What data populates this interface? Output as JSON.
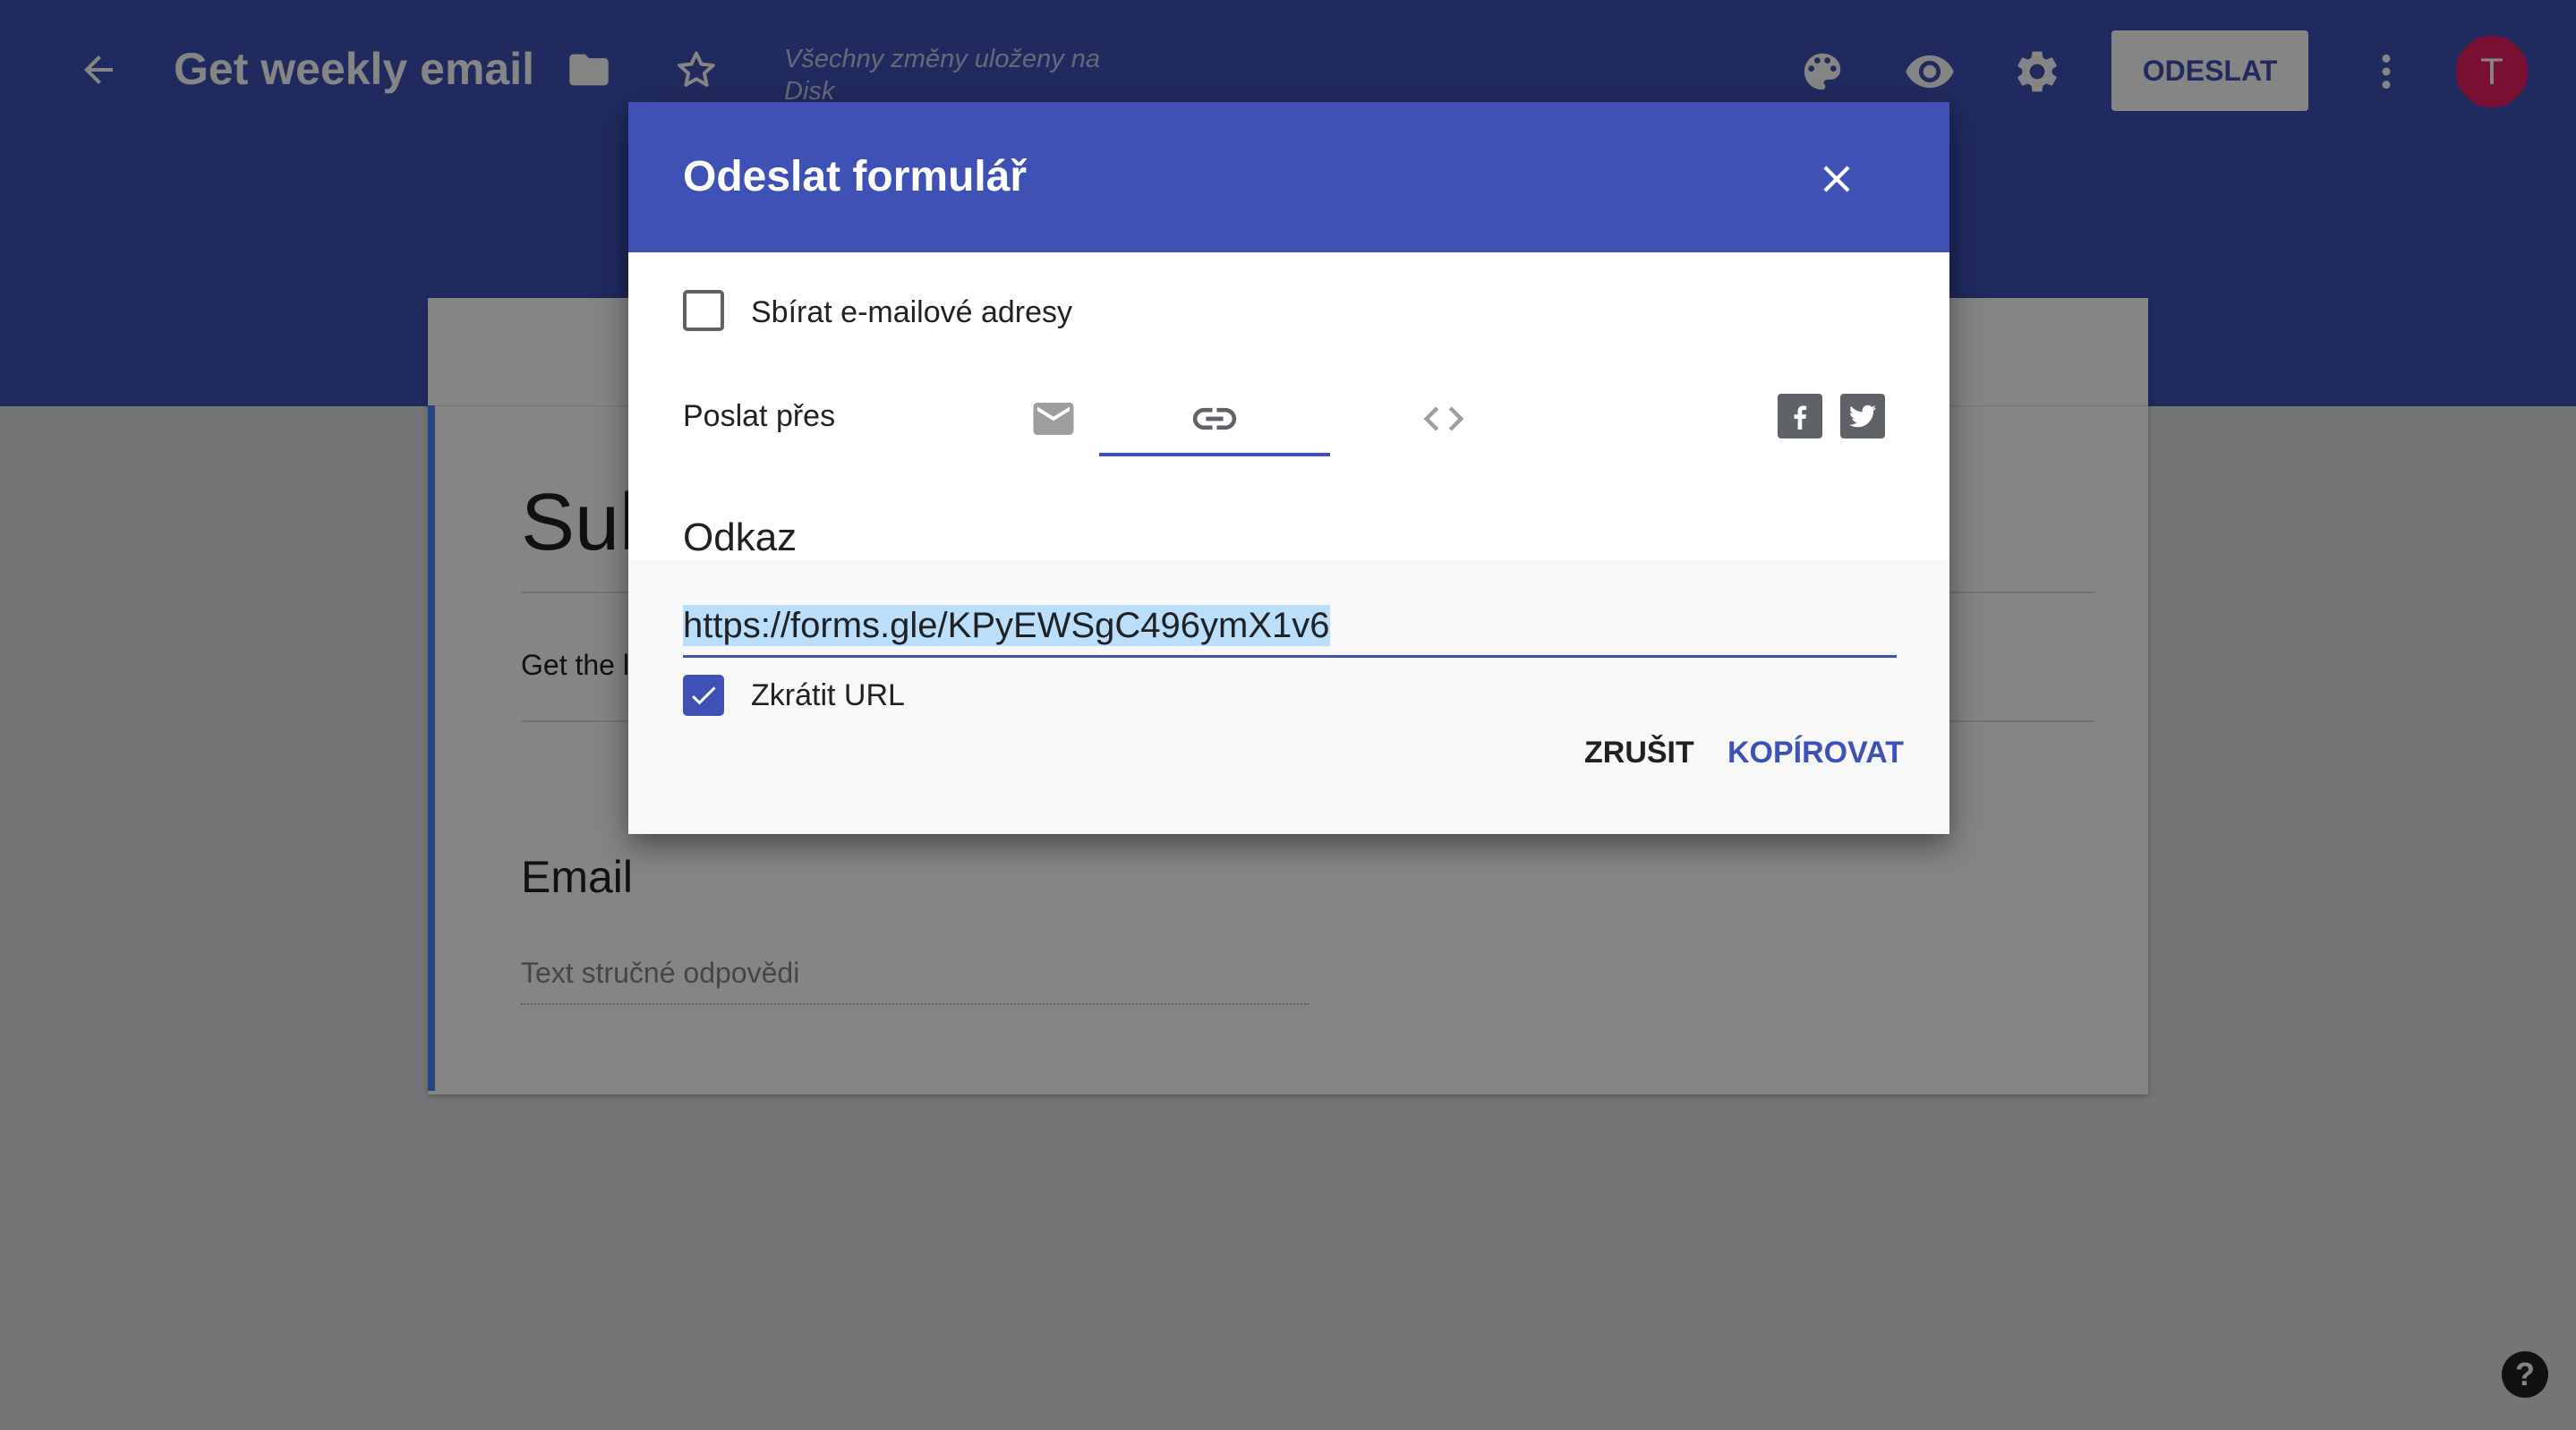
{
  "colors": {
    "primary": "#3f51b5",
    "avatar": "#e91e63",
    "accent_bar": "#4285f4",
    "selection": "#bbdefb"
  },
  "topbar": {
    "back_icon": "arrow-back-icon",
    "title": "Get weekly email",
    "folder_icon": "folder-icon",
    "star_icon": "star-outline-icon",
    "save_status": "Všechny změny uloženy na Disk",
    "palette_icon": "palette-icon",
    "preview_icon": "eye-icon",
    "settings_icon": "gear-icon",
    "send_label": "ODESLAT",
    "more_icon": "more-vert-icon",
    "avatar_letter": "T"
  },
  "form": {
    "title_partial": "Sub",
    "description_partial": "Get the l",
    "question_title": "Email",
    "answer_placeholder": "Text stručné odpovědi"
  },
  "dialog": {
    "title": "Odeslat formulář",
    "close_icon": "close-icon",
    "collect_emails_label": "Sbírat e-mailové adresy",
    "collect_emails_checked": false,
    "send_via_label": "Poslat přes",
    "tabs": [
      {
        "icon": "email-icon",
        "selected": false
      },
      {
        "icon": "link-icon",
        "selected": true
      },
      {
        "icon": "embed-code-icon",
        "selected": false
      }
    ],
    "social": [
      {
        "icon": "facebook-icon"
      },
      {
        "icon": "twitter-icon"
      }
    ],
    "link_section_title": "Odkaz",
    "link_url": "https://forms.gle/KPyEWSgC496ymX1v6",
    "shorten_label": "Zkrátit URL",
    "shorten_checked": true,
    "cancel_label": "ZRUŠIT",
    "copy_label": "KOPÍROVAT"
  },
  "help_label": "?"
}
